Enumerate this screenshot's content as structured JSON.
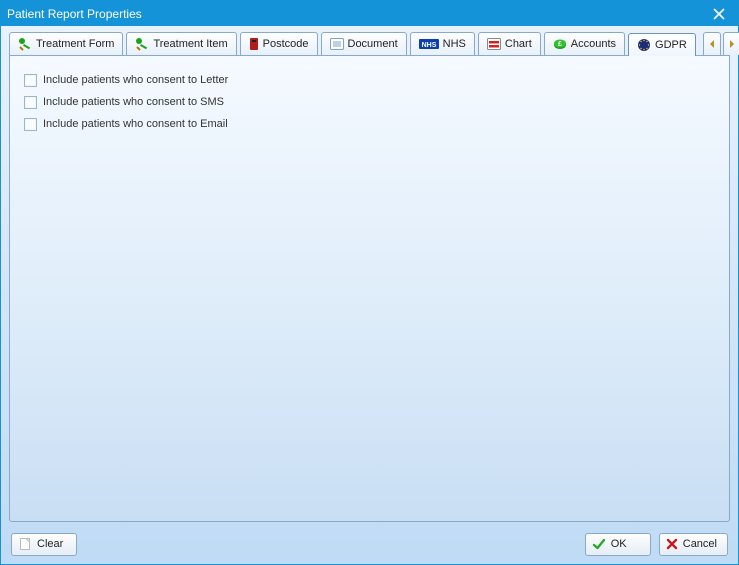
{
  "window": {
    "title": "Patient Report Properties"
  },
  "tabs": [
    {
      "label": "Treatment Form"
    },
    {
      "label": "Treatment Item"
    },
    {
      "label": "Postcode"
    },
    {
      "label": "Document"
    },
    {
      "label": "NHS"
    },
    {
      "label": "Chart"
    },
    {
      "label": "Accounts"
    },
    {
      "label": "GDPR"
    }
  ],
  "options": [
    {
      "label": "Include patients who consent to Letter"
    },
    {
      "label": "Include patients who consent to SMS"
    },
    {
      "label": "Include patients who consent to Email"
    }
  ],
  "buttons": {
    "clear": "Clear",
    "ok": "OK",
    "cancel": "Cancel"
  }
}
